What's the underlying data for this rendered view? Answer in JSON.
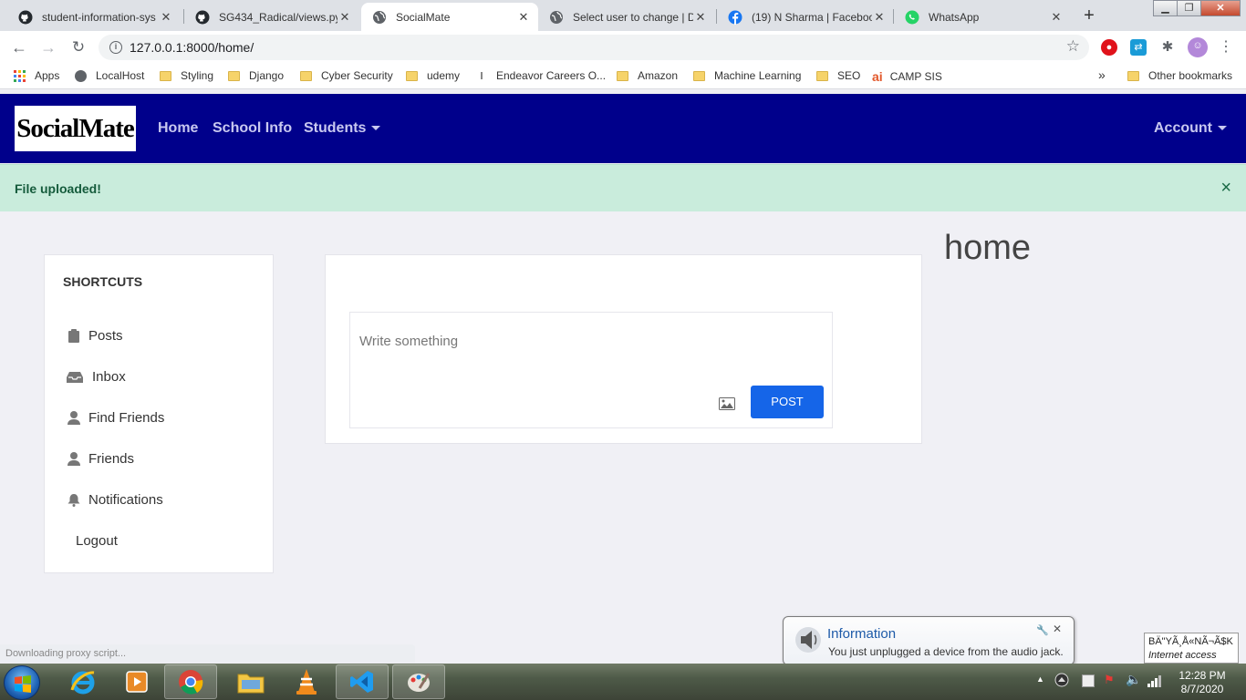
{
  "browser": {
    "tabs": [
      {
        "title": "student-information-sys",
        "icon": "github-icon"
      },
      {
        "title": "SG434_Radical/views.py",
        "icon": "github-icon"
      },
      {
        "title": "SocialMate",
        "icon": "globe-icon"
      },
      {
        "title": "Select user to change | D",
        "icon": "globe-icon"
      },
      {
        "title": "(19) N Sharma | Faceboo",
        "icon": "facebook-icon"
      },
      {
        "title": "WhatsApp",
        "icon": "whatsapp-icon"
      }
    ],
    "url": "127.0.0.1:8000/home/",
    "bookmarks": [
      "Apps",
      "LocalHost",
      "Styling",
      "Django",
      "Cyber Security",
      "udemy",
      "Endeavor Careers O...",
      "Amazon",
      "Machine Learning",
      "SEO",
      "CAMP SIS"
    ],
    "more_bookmarks": "»",
    "other_bookmarks": "Other bookmarks",
    "status": "Downloading proxy script..."
  },
  "navbar": {
    "logo": "SocialMate",
    "links": [
      "Home",
      "School Info",
      "Students"
    ],
    "account": "Account",
    "bg_color": "#00008b"
  },
  "alert": {
    "message": "File uploaded!",
    "close": "×",
    "bg_color": "#c9ecdc"
  },
  "page": {
    "title": "home"
  },
  "sidebar": {
    "heading": "SHORTCUTS",
    "items": [
      {
        "label": "Posts",
        "icon": "clipboard-icon"
      },
      {
        "label": "Inbox",
        "icon": "inbox-icon"
      },
      {
        "label": "Find Friends",
        "icon": "user-icon"
      },
      {
        "label": "Friends",
        "icon": "user-icon"
      },
      {
        "label": "Notifications",
        "icon": "bell-icon"
      },
      {
        "label": "Logout",
        "icon": ""
      }
    ]
  },
  "composer": {
    "placeholder": "Write something",
    "post_label": "POST",
    "accent": "#1565e8"
  },
  "notification": {
    "title": "Information",
    "text": "You just unplugged a device from the audio jack."
  },
  "network_tooltip": {
    "line1": "BÄ\"YÃ¸Å«NÃ¬Ã$K",
    "line2": "Internet access"
  },
  "taskbar": {
    "time": "12:28 PM",
    "date": "8/7/2020"
  }
}
